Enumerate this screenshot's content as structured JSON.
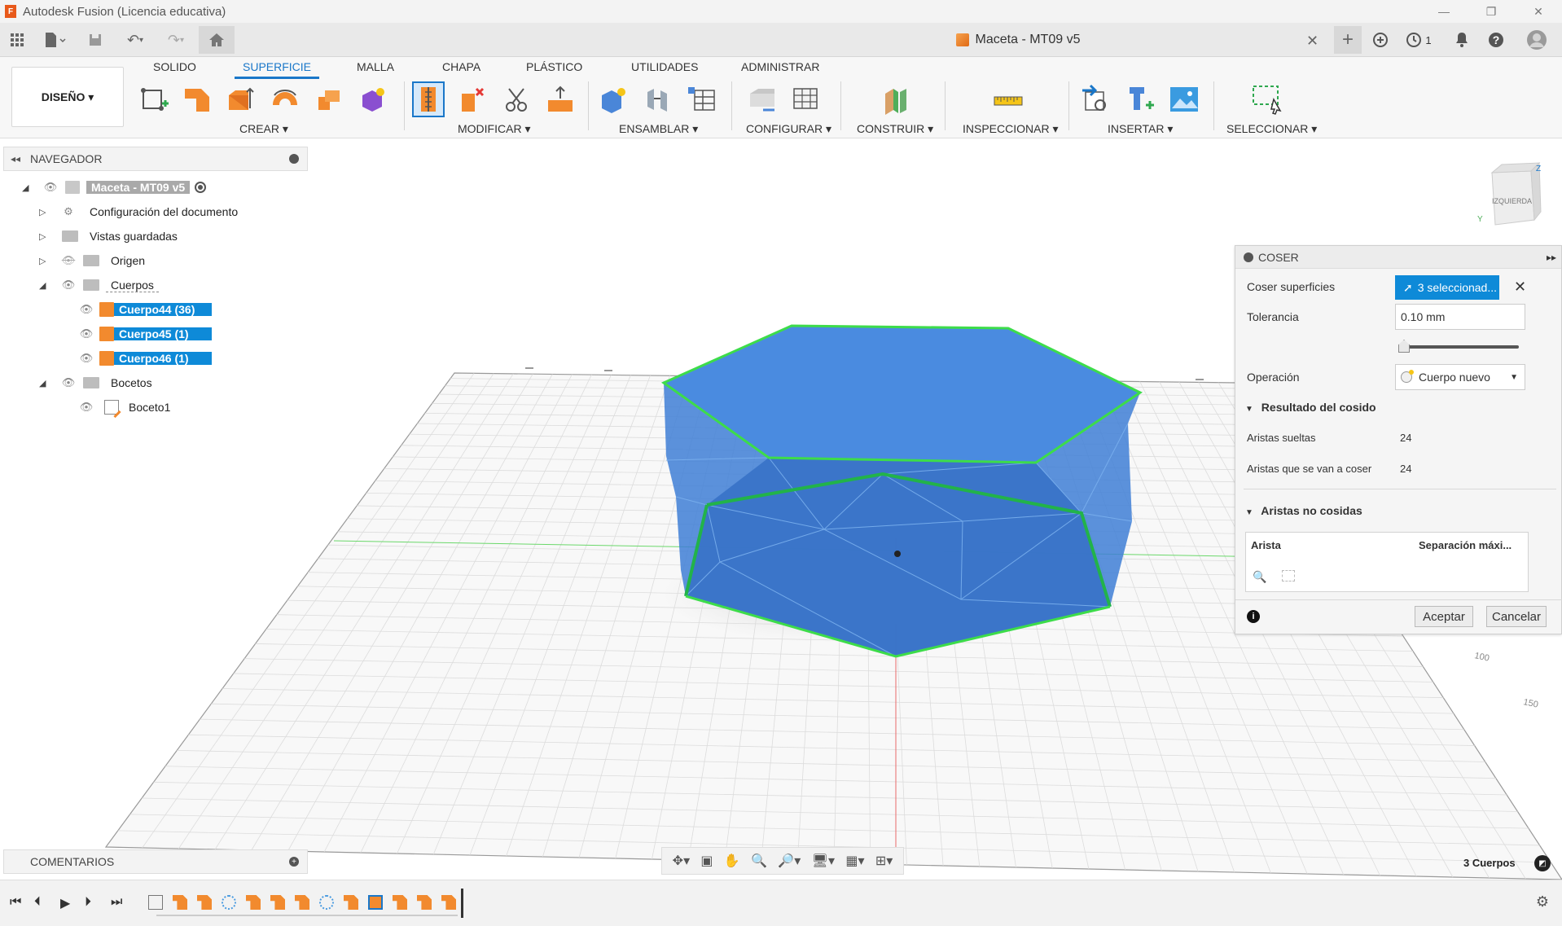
{
  "window": {
    "title": "Autodesk Fusion (Licencia educativa)",
    "app_icon_letter": "F"
  },
  "document": {
    "tab_title": "Maceta - MT09 v5",
    "notifications_count": "1"
  },
  "ribbon": {
    "workspace": "DISEÑO ▾",
    "tabs": [
      "SOLIDO",
      "SUPERFICIE",
      "MALLA",
      "CHAPA",
      "PLÁSTICO",
      "UTILIDADES",
      "ADMINISTRAR"
    ],
    "active_tab": "SUPERFICIE",
    "groups": [
      "CREAR ▾",
      "MODIFICAR ▾",
      "ENSAMBLAR ▾",
      "CONFIGURAR ▾",
      "CONSTRUIR ▾",
      "INSPECCIONAR ▾",
      "INSERTAR ▾",
      "SELECCIONAR ▾"
    ]
  },
  "navigator": {
    "title": "NAVEGADOR",
    "root": "Maceta - MT09 v5",
    "items": [
      {
        "label": "Configuración del documento"
      },
      {
        "label": "Vistas guardadas"
      },
      {
        "label": "Origen"
      },
      {
        "label": "Cuerpos"
      },
      {
        "label": "Cuerpo44 (36)"
      },
      {
        "label": "Cuerpo45 (1)"
      },
      {
        "label": "Cuerpo46 (1)"
      },
      {
        "label": "Bocetos"
      },
      {
        "label": "Boceto1"
      }
    ]
  },
  "viewcube": {
    "face_label": "IZQUIERDA",
    "axis_z": "Z",
    "axis_y": "Y"
  },
  "grid_labels": [
    "100",
    "150"
  ],
  "coser_panel": {
    "title": "COSER",
    "coser_superficies_label": "Coser superficies",
    "selection_button": "3 seleccionad...",
    "tolerancia_label": "Tolerancia",
    "tolerancia_value": "0.10 mm",
    "tolerance_slider_level": 0.0,
    "operacion_label": "Operación",
    "operacion_value": "Cuerpo nuevo",
    "resultado_title": "Resultado del cosido",
    "aristas_sueltas_label": "Aristas sueltas",
    "aristas_sueltas_value": "24",
    "aristas_coser_label": "Aristas que se van a coser",
    "aristas_coser_value": "24",
    "no_cosidas_title": "Aristas no cosidas",
    "col_arista": "Arista",
    "col_separacion": "Separación máxi...",
    "accept": "Aceptar",
    "cancel": "Cancelar"
  },
  "bottom": {
    "comments": "COMENTARIOS",
    "bodies_count": "3 Cuerpos"
  },
  "colors": {
    "accent": "#1a77c9",
    "selection_blue": "#0e8ad8",
    "body_blue": "#4a86d8",
    "highlight_green": "#3ddc4a",
    "tool_orange": "#f28a2e"
  }
}
